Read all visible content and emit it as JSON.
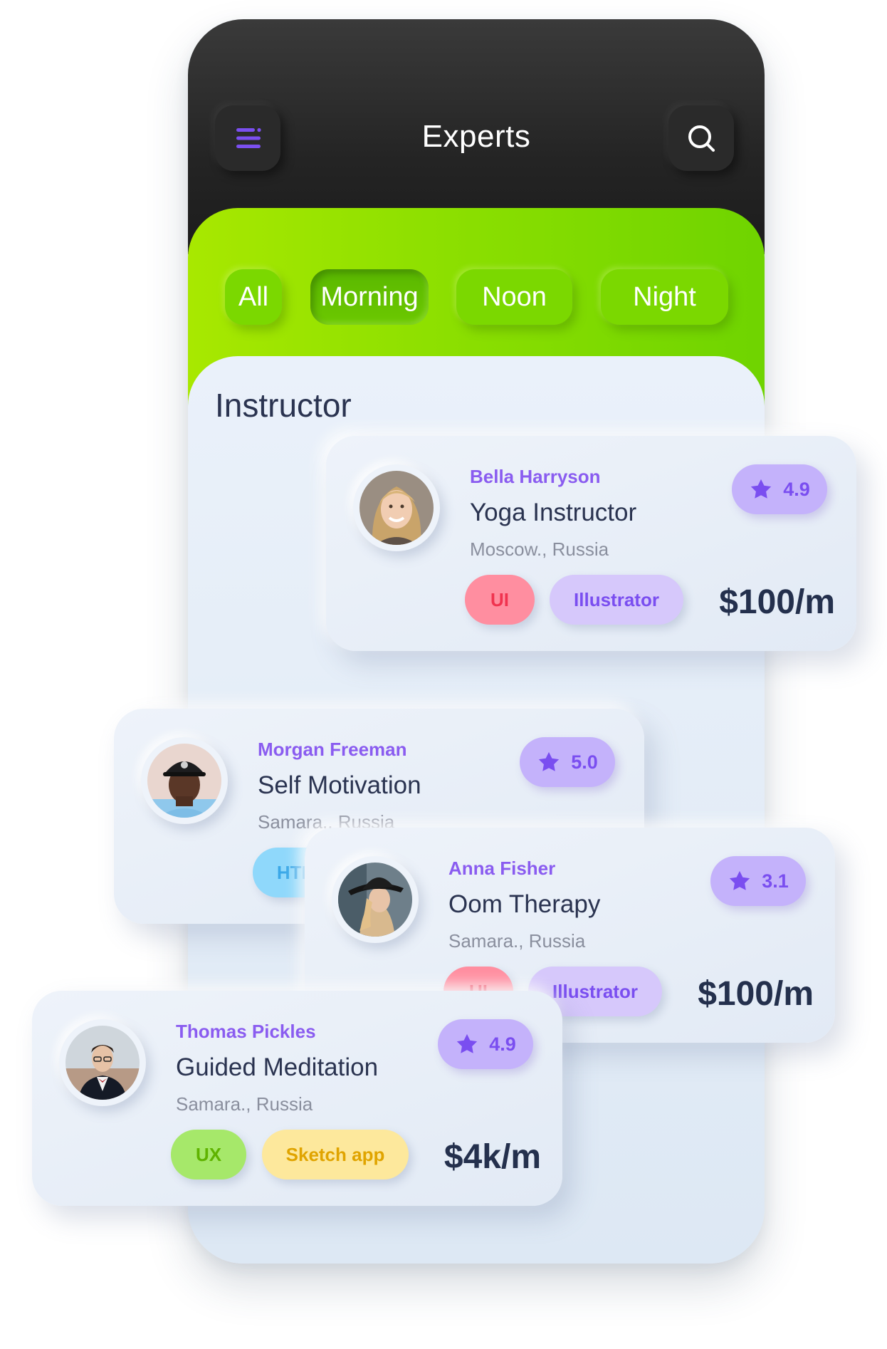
{
  "header": {
    "title": "Experts"
  },
  "filters": [
    "All",
    "Morning",
    "Noon",
    "Night"
  ],
  "section_title": "Instructor",
  "cards": [
    {
      "name": "Bella Harryson",
      "role": "Yoga Instructor",
      "location": "Moscow., Russia",
      "rating": "4.9",
      "tags": [
        "UI",
        "Illustrator"
      ],
      "price": "$100/m"
    },
    {
      "name": "Morgan Freeman",
      "role": "Self Motivation",
      "location": "Samara., Russia",
      "rating": "5.0",
      "tags": [
        "HTML"
      ],
      "price": ""
    },
    {
      "name": "Anna Fisher",
      "role": "Oom Therapy",
      "location": "Samara., Russia",
      "rating": "3.1",
      "tags": [
        "UI",
        "Illustrator"
      ],
      "price": "$100/m"
    },
    {
      "name": "Thomas Pickles",
      "role": "Guided Meditation",
      "location": "Samara., Russia",
      "rating": "4.9",
      "tags": [
        "UX",
        "Sketch app"
      ],
      "price": "$4k/m"
    }
  ],
  "colors": {
    "accent_purple": "#8a5cf0",
    "header_dark": "#242424",
    "filter_green": "#8fe000",
    "tag_ui_bg": "#ff8ea0",
    "tag_illustrator_bg": "#d6c8fb",
    "tag_html_bg": "#8fd8fb",
    "tag_ux_bg": "#a6e86a",
    "tag_sketch_bg": "#fde89c"
  },
  "icons": {
    "menu": "menu-icon",
    "search": "search-icon",
    "star": "star-icon"
  }
}
